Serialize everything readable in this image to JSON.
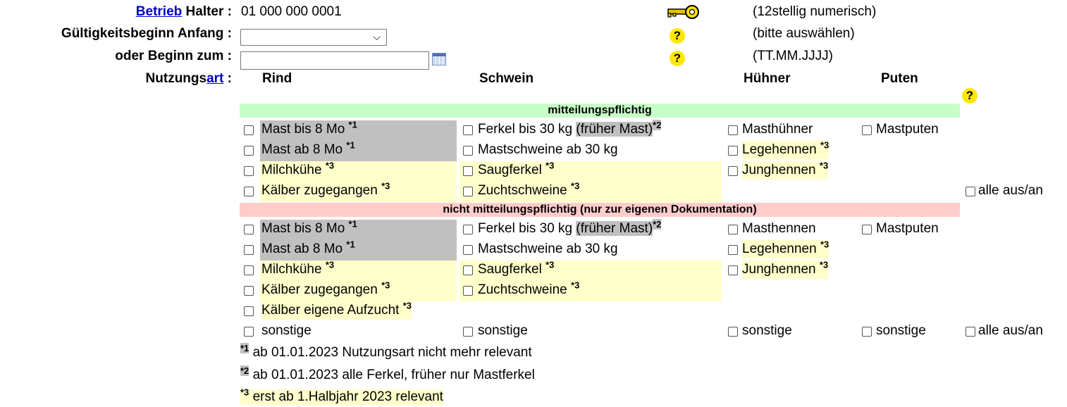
{
  "form": {
    "betrieb_link": "Betrieb",
    "halter_label": "Halter :",
    "halter_value": "01 000 000 0001",
    "halter_hint": "(12stellig numerisch)",
    "gueltig_label": "Gültigkeitsbeginn Anfang :",
    "gueltig_value": "",
    "gueltig_hint": "(bitte auswählen)",
    "beginn_label": "oder Beginn zum :",
    "beginn_value": "",
    "beginn_hint": "(TT.MM.JJJJ)",
    "nutzung_prefix": "Nutzungs",
    "nutzung_link": "art",
    "nutzung_suffix": " :",
    "help_glyph": "?"
  },
  "columns": {
    "rind": "Rind",
    "schwein": "Schwein",
    "huehner": "Hühner",
    "puten": "Puten"
  },
  "bands": {
    "mitteilungspflichtig": "mitteilungspflichtig",
    "nicht": "nicht mitteilungspflichtig (nur zur eigenen Dokumentation)"
  },
  "section1": {
    "rind": [
      "Mast bis 8 Mo ",
      "Mast ab 8 Mo ",
      "Milchkühe ",
      "Kälber zugegangen "
    ],
    "rind_marks": [
      "*1",
      "*1",
      "*3",
      "*3"
    ],
    "schwein_a": "Ferkel bis 30 kg ",
    "schwein_a_extra": "(früher Mast)",
    "schwein_a_mark": "*2",
    "schwein": [
      "Mastschweine ab 30 kg",
      "Saugferkel ",
      "Zuchtschweine "
    ],
    "schwein_marks": [
      "",
      "*3",
      "*3"
    ],
    "huehner": [
      "Masthühner",
      "Legehennen ",
      "Junghennen "
    ],
    "huehner_marks": [
      "",
      "*3",
      "*3"
    ],
    "puten": [
      "Mastputen"
    ],
    "alle": "alle aus/an"
  },
  "section2": {
    "rind": [
      "Mast bis 8 Mo ",
      "Mast ab 8 Mo ",
      "Milchkühe ",
      "Kälber zugegangen ",
      "Kälber eigene Aufzucht ",
      "sonstige"
    ],
    "rind_marks": [
      "*1",
      "*1",
      "*3",
      "*3",
      "*3",
      ""
    ],
    "schwein_a": "Ferkel bis 30 kg ",
    "schwein_a_extra": "(früher Mast)",
    "schwein_a_mark": "*2",
    "schwein": [
      "Mastschweine ab 30 kg",
      "Saugferkel ",
      "Zuchtschweine ",
      "sonstige"
    ],
    "schwein_marks": [
      "",
      "*3",
      "*3",
      ""
    ],
    "huehner": [
      "Masthennen",
      "Legehennen ",
      "Junghennen ",
      "sonstige"
    ],
    "huehner_marks": [
      "",
      "*3",
      "*3",
      ""
    ],
    "puten": [
      "Mastputen",
      "sonstige"
    ],
    "alle": "alle aus/an"
  },
  "footnotes": [
    {
      "mark": "*1",
      "text": " ab 01.01.2023 Nutzungsart nicht mehr relevant"
    },
    {
      "mark": "*2",
      "text": " ab 01.01.2023 alle Ferkel, früher nur Mastferkel"
    },
    {
      "mark": "*3",
      "text": " erst ab 1.Halbjahr 2023 relevant"
    }
  ],
  "icons": {
    "key": "key-icon",
    "help": "help-icon",
    "calendar": "calendar-icon"
  },
  "colors": {
    "green_band": "#c8ffc8",
    "red_band": "#ffcccc",
    "gray_cell": "#c0c0c0",
    "yellow_cell": "#ffffcc",
    "help_bg": "#ffe800",
    "link": "#0000cc"
  }
}
